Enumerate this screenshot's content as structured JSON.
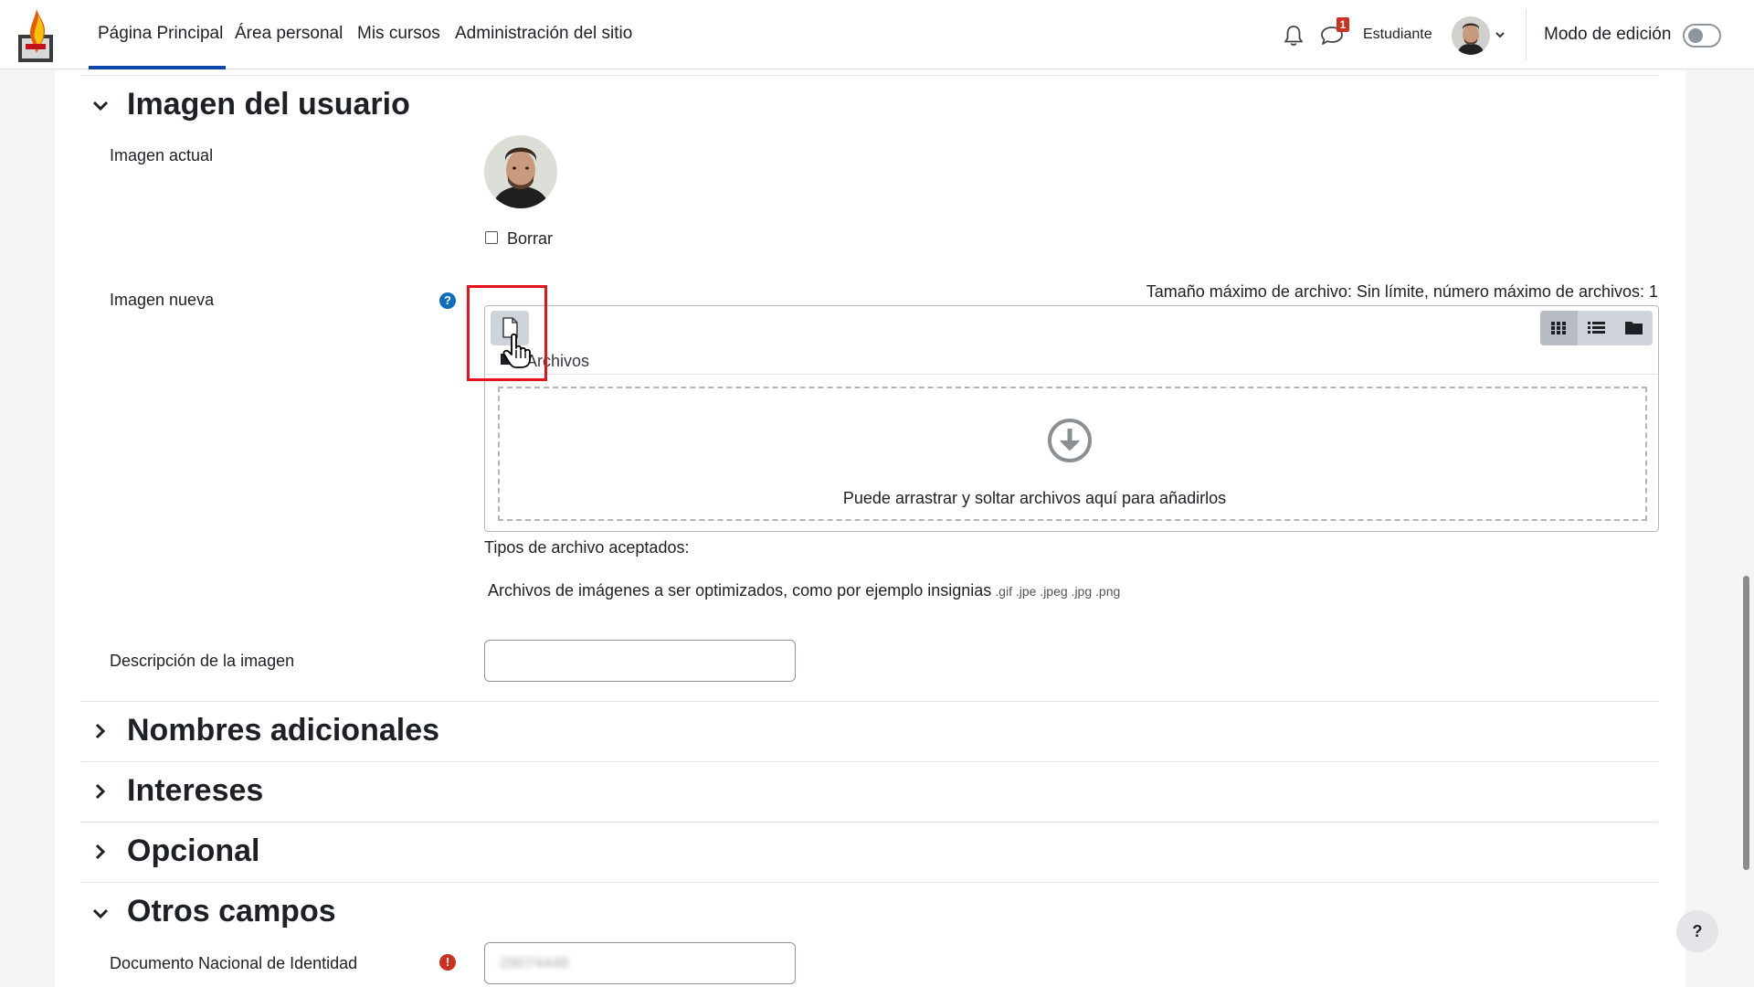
{
  "navbar": {
    "items": [
      {
        "label": "Página Principal",
        "active": true
      },
      {
        "label": "Área personal"
      },
      {
        "label": "Mis cursos"
      },
      {
        "label": "Administración del sitio"
      }
    ],
    "messages_badge": "1",
    "role": "Estudiante",
    "edit_mode_label": "Modo de edición",
    "edit_mode_on": false
  },
  "sections": {
    "user_image": {
      "title": "Imagen del usuario",
      "current_image_label": "Imagen actual",
      "delete_label": "Borrar",
      "new_image_label": "Imagen nueva",
      "max_size_text": "Tamaño máximo de archivo: Sin límite, número máximo de archivos: 1",
      "filepicker": {
        "path_label": "Archivos",
        "dropzone_text": "Puede arrastrar y soltar archivos aquí para añadirlos"
      },
      "accepted_types_title": "Tipos de archivo aceptados:",
      "accepted_types_desc": "Archivos de imágenes a ser optimizados, como por ejemplo insignias",
      "accepted_types_ext": ".gif .jpe .jpeg .jpg .png",
      "image_description_label": "Descripción de la imagen",
      "image_description_value": ""
    },
    "additional_names": {
      "title": "Nombres adicionales"
    },
    "interests": {
      "title": "Intereses"
    },
    "optional": {
      "title": "Opcional"
    },
    "other_fields": {
      "title": "Otros campos",
      "dni_label": "Documento Nacional de Identidad",
      "dni_value": "29074448"
    }
  },
  "help_fab": "?",
  "colors": {
    "primary": "#0f47ad",
    "info": "#0f6cbf",
    "danger": "#ca3120",
    "highlight": "#e3121b"
  },
  "icons": [
    "bell-icon",
    "chat-icon",
    "caret-down-icon",
    "file-add-icon",
    "folder-icon",
    "grid-view-icon",
    "list-view-icon",
    "tree-view-icon",
    "download-circle-icon",
    "help-icon",
    "required-icon",
    "hand-cursor-icon"
  ]
}
